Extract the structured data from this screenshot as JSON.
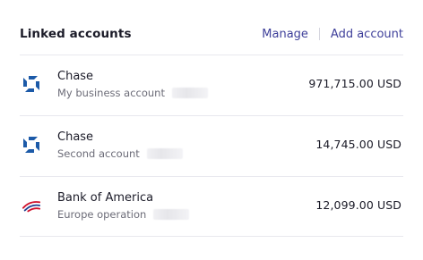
{
  "header": {
    "title": "Linked accounts",
    "manage_label": "Manage",
    "add_label": "Add account"
  },
  "accounts": [
    {
      "bank": "Chase",
      "label": "My business account",
      "amount": "971,715.00",
      "currency": "USD",
      "icon": "chase-logo"
    },
    {
      "bank": "Chase",
      "label": "Second account",
      "amount": "14,745.00",
      "currency": "USD",
      "icon": "chase-logo"
    },
    {
      "bank": "Bank of America",
      "label": "Europe operation",
      "amount": "12,099.00",
      "currency": "USD",
      "icon": "bank-of-america-logo"
    }
  ],
  "colors": {
    "chase_blue": "#1c5aa8",
    "boa_red": "#d0112b",
    "boa_navy": "#1f3f8f",
    "link": "#3e3f9a"
  }
}
